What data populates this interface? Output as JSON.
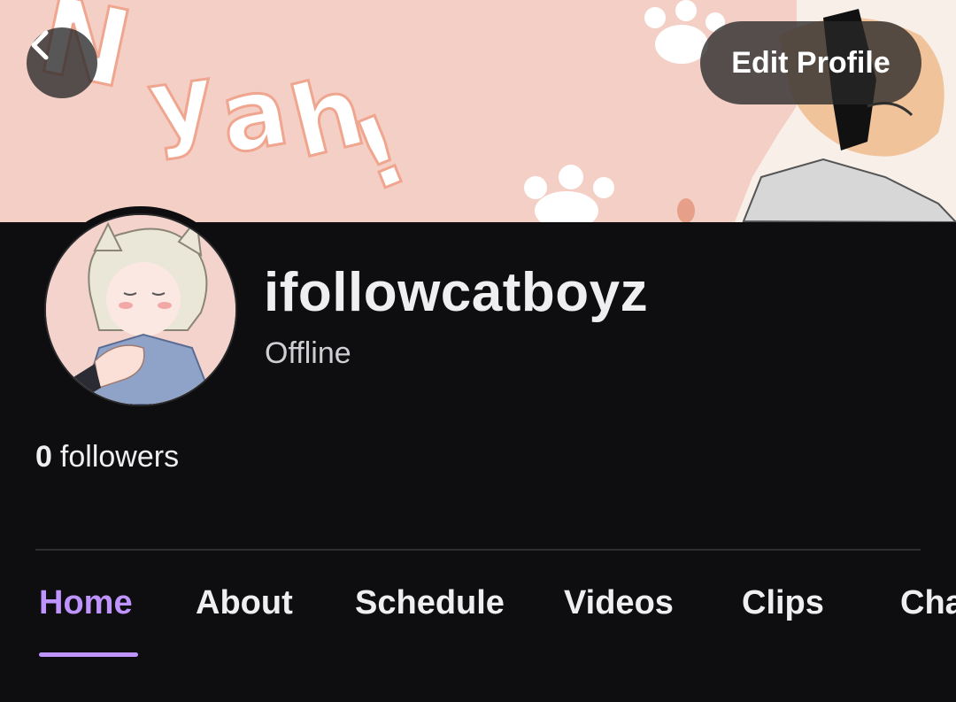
{
  "banner": {
    "background_color": "#f4cfc6",
    "art_text": "Nyah!"
  },
  "header": {
    "back_icon": "chevron-left-icon",
    "edit_profile_label": "Edit Profile"
  },
  "profile": {
    "username": "ifollowcatboyz",
    "status": "Offline",
    "follower_count": "0",
    "followers_label": "followers"
  },
  "tabs": [
    {
      "label": "Home",
      "active": true
    },
    {
      "label": "About",
      "active": false
    },
    {
      "label": "Schedule",
      "active": false
    },
    {
      "label": "Videos",
      "active": false
    },
    {
      "label": "Clips",
      "active": false
    },
    {
      "label": "Cha",
      "active": false
    }
  ],
  "colors": {
    "accent": "#bf94ff",
    "background": "#0e0e10"
  }
}
